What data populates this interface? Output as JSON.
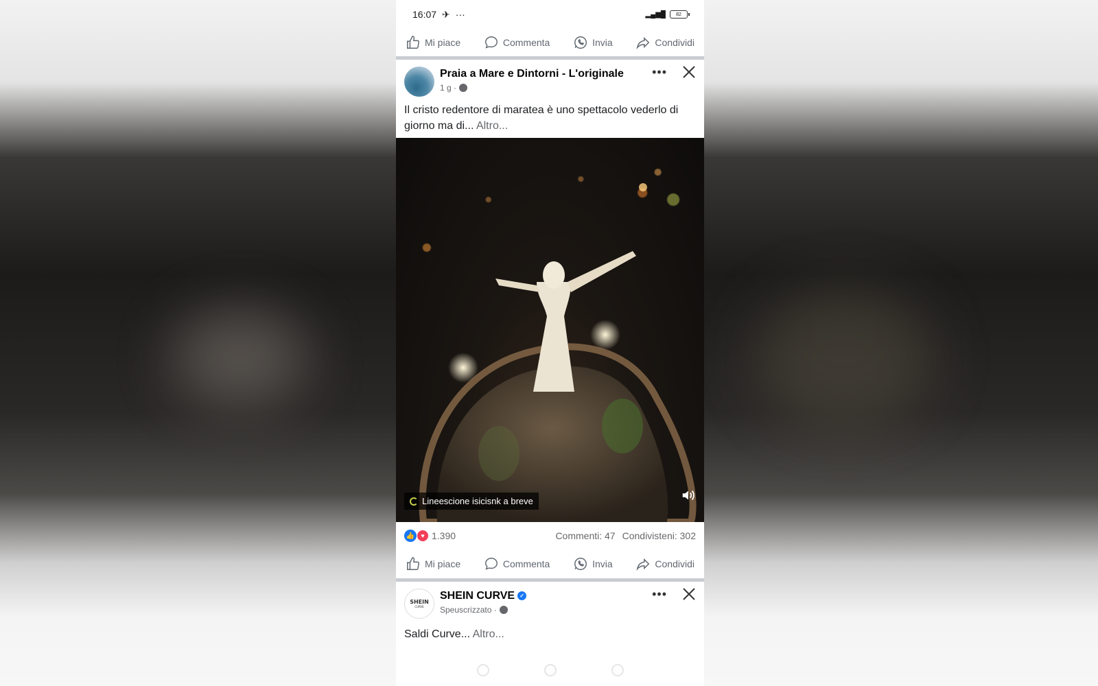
{
  "status_bar": {
    "time": "16:07",
    "indicators": "···",
    "battery": "82"
  },
  "action_bar_top": {
    "like": "Mi piace",
    "comment": "Commenta",
    "send": "Invia",
    "share": "Condividi"
  },
  "post1": {
    "author": "Praia a Mare e Dintorni - L'originale",
    "time": "1 g ·",
    "text": "Il cristo redentore di maratea è uno spettacolo vederlo di giorno ma di...",
    "more": "Altro...",
    "caption_chip": "Lineescione isicisnk a breve",
    "reactions_count": "1.390",
    "comments": "Commenti: 47",
    "shares": "Condivisteni: 302"
  },
  "action_bar_bottom": {
    "like": "Mi piace",
    "comment": "Commenta",
    "send": "Invia",
    "share": "Condividi"
  },
  "post2": {
    "author": "SHEIN CURVE",
    "avatar_text": "SHEIN",
    "avatar_sub": "CURVE",
    "sub": "Speuscrizzato ·",
    "text": "Saldi Curve...",
    "more": "Altro..."
  },
  "icons": [
    "like-icon",
    "comment-icon",
    "whatsapp-icon",
    "share-icon",
    "globe-icon",
    "more-dots-icon",
    "close-icon",
    "volume-icon",
    "verified-icon"
  ],
  "colors": {
    "brand_blue": "#1877f2",
    "love_red": "#f33e58",
    "text_secondary": "#65676b"
  }
}
